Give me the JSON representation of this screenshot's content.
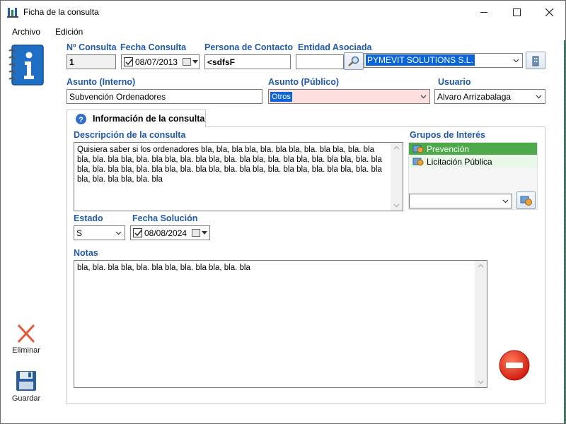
{
  "window": {
    "title": "Ficha de la consulta"
  },
  "menu": {
    "items": [
      "Archivo",
      "Edición"
    ]
  },
  "form": {
    "num_consulta": {
      "label": "Nº Consulta",
      "value": "1"
    },
    "fecha_consulta": {
      "label": "Fecha Consulta",
      "value": "08/07/2013"
    },
    "persona_contacto": {
      "label": "Persona de Contacto",
      "value": "<sdfsF"
    },
    "entidad_asociada": {
      "label": "Entidad Asociada",
      "code": "",
      "value": "PYMEVIT SOLUTIONS S.L."
    },
    "asunto_interno": {
      "label": "Asunto (Interno)",
      "value": "Subvención Ordenadores"
    },
    "asunto_publico": {
      "label": "Asunto (Público)",
      "value": "Otros"
    },
    "usuario": {
      "label": "Usuario",
      "value": "Alvaro Arrizabalaga"
    }
  },
  "tab": {
    "label": "Información de la consulta"
  },
  "info": {
    "descripcion": {
      "label": "Descripción de la consulta",
      "value": "Quisiera saber si los ordenadores bla, bla, bla bla, bla. bla bla, bla. bla bla, bla. bla bla, bla. bla bla, bla. bla bla, bla. bla bla, bla. bla bla, bla. bla bla, bla. bla bla, bla. bla bla, bla. bla bla, bla. bla bla, bla. bla bla, bla. bla bla, bla. bla bla, bla. bla bla, bla. bla bla, bla. bla bla, bla. bla"
    },
    "grupos": {
      "label": "Grupos de Interés",
      "items": [
        "Prevención",
        "Licitación Pública"
      ],
      "combo_value": ""
    },
    "estado": {
      "label": "Estado",
      "value": "S"
    },
    "fecha_solucion": {
      "label": "Fecha Solución",
      "value": "08/08/2024"
    },
    "notas": {
      "label": "Notas",
      "value": "bla, bla. bla bla, bla. bla bla, bla. bla bla, bla. bla"
    }
  },
  "sidebar": {
    "eliminar": "Eliminar",
    "guardar": "Guardar"
  },
  "colors": {
    "label_blue": "#2159a8",
    "selection_green": "#4da94a",
    "background_teal": "#2a7a64",
    "delete_red": "#e03020"
  }
}
